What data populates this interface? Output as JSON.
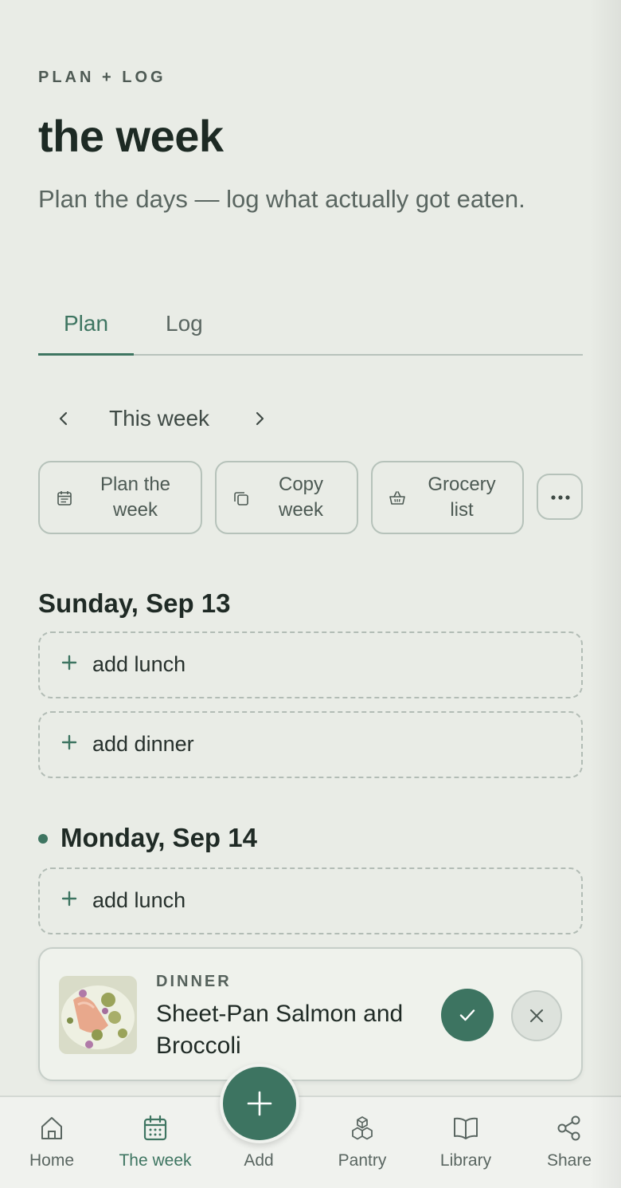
{
  "header": {
    "eyebrow": "PLAN + LOG",
    "title": "the week",
    "subtitle": "Plan the days — log what actually got eaten."
  },
  "tabs": [
    {
      "label": "Plan",
      "active": true
    },
    {
      "label": "Log",
      "active": false
    }
  ],
  "week_nav": {
    "label": "This week",
    "prev_icon": "chevron-left-icon",
    "next_icon": "chevron-right-icon"
  },
  "actions": {
    "plan_week": {
      "line1": "Plan the",
      "line2": "week",
      "icon": "calendar-icon"
    },
    "copy_week": {
      "line1": "Copy",
      "line2": "week",
      "icon": "copy-icon"
    },
    "grocery_list": {
      "line1": "Grocery",
      "line2": "list",
      "icon": "basket-icon"
    },
    "more_icon": "more-icon"
  },
  "days": [
    {
      "heading": "Sunday, Sep 13",
      "slots": [
        {
          "label": "add lunch"
        },
        {
          "label": "add dinner"
        }
      ]
    },
    {
      "heading": "Monday, Sep 14",
      "today": true,
      "slots": [
        {
          "label": "add lunch"
        }
      ],
      "meal": {
        "type": "DINNER",
        "name": "Sheet-Pan Salmon and Broccoli"
      }
    }
  ],
  "bottom_nav": [
    {
      "label": "Home",
      "icon": "home-icon",
      "active": false
    },
    {
      "label": "The week",
      "icon": "calendar-icon",
      "active": true
    },
    {
      "label": "Add",
      "icon": "plus-icon",
      "active": false
    },
    {
      "label": "Pantry",
      "icon": "boxes-icon",
      "active": false
    },
    {
      "label": "Library",
      "icon": "book-icon",
      "active": false
    },
    {
      "label": "Share",
      "icon": "share-icon",
      "active": false
    }
  ],
  "colors": {
    "background": "#e9ece6",
    "accent": "#3d7461",
    "text": "#1f2a25",
    "muted": "#5a6661"
  }
}
